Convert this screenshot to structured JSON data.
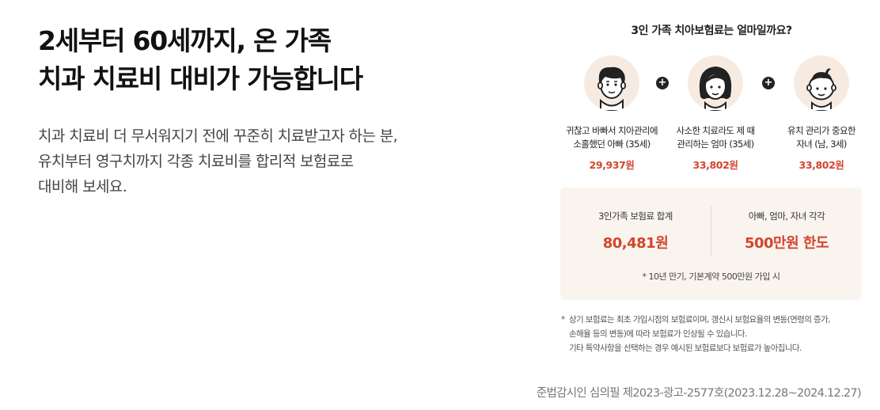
{
  "headline": {
    "line1": "2세부터 60세까지, 온 가족",
    "line2": "치과 치료비 대비가 가능합니다"
  },
  "description": {
    "line1": "치과 치료비 더 무서워지기 전에 꾸준히 치료받고자 하는 분,",
    "line2": "유치부터 영구치까지 각종 치료비를 합리적 보험료로",
    "line3": "대비해 보세요."
  },
  "panel": {
    "title": "3인 가족 치아보험료는 얼마일까요?",
    "plus_symbol": "+",
    "members": [
      {
        "icon": "father-face-icon",
        "label_line1": "귀찮고 바빠서 치아관리에",
        "label_line2": "소홀했던 아빠 (35세)",
        "price": "29,937원"
      },
      {
        "icon": "mother-face-icon",
        "label_line1": "사소한 치료라도 제 때",
        "label_line2": "관리하는 엄마 (35세)",
        "price": "33,802원"
      },
      {
        "icon": "child-face-icon",
        "label_line1": "유치 관리가 중요한",
        "label_line2": "자녀 (남, 3세)",
        "price": "33,802원"
      }
    ],
    "summary": {
      "total_label": "3인가족 보험료 합계",
      "total_value": "80,481원",
      "limit_label": "아빠, 엄마, 자녀 각각",
      "limit_value": "500만원 한도",
      "note": "* 10년 만기, 기본계약 500만원 가입 시"
    },
    "disclaimer": {
      "star": "*",
      "line1": "상기 보험료는 최초 가입시점의 보험료이며, 갱신시 보험요율의 변동(연령의 증가,",
      "line2": "손해율 등의 변동)에 따라 보험료가 인상될 수 있습니다.",
      "line3": "기타 특약사항을 선택하는 경우 예시된 보험료보다 보험료가 높아집니다."
    }
  },
  "approval": "준법감시인 심의필 제2023-광고-2577호(2023.12.28~2024.12.27)",
  "colors": {
    "accent": "#d2452d",
    "avatar_bg": "#f7ebe1",
    "summary_bg": "#faf4ef"
  }
}
